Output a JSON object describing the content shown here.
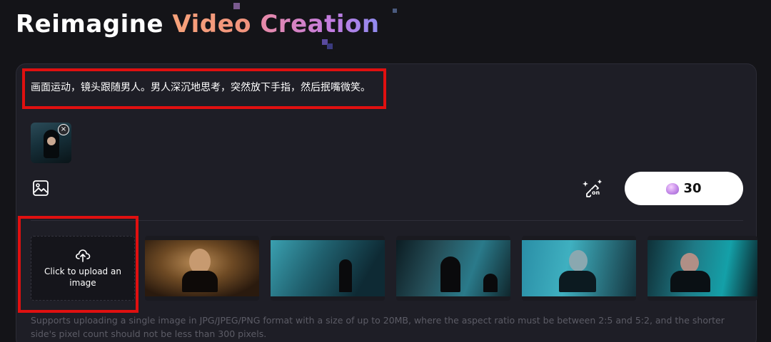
{
  "hero": {
    "word1": "Reimagine",
    "word2": "Video",
    "word3": "Creation"
  },
  "prompt": {
    "text": "画面运动，镜头跟随男人。男人深沉地思考，突然放下手指，然后抿嘴微笑。"
  },
  "reference_image": {
    "remove_glyph": "×"
  },
  "toolbar": {
    "image_icon": "image-icon",
    "ai_toggle_icon": "magic-edit-icon",
    "ai_toggle_label": "on",
    "credits_value": "30",
    "credits_icon": "shell-gem-icon"
  },
  "upload": {
    "icon": "cloud-upload-icon",
    "label": "Click to upload an image"
  },
  "gallery": {
    "frames": [
      "f1",
      "f2",
      "f3",
      "f4",
      "f5"
    ]
  },
  "hint": "Supports uploading a single image in JPG/JPEG/PNG format with a size of up to 20MB, where the aspect ratio must be between 2:5 and 5:2, and the shorter side's pixel count should not be less than 300 pixels.",
  "colors": {
    "background": "#141418",
    "card": "#1e1e26",
    "highlight_box": "#e01010",
    "gradient_orange": "#f7a27a",
    "gradient_pink": "#e88aa6",
    "gradient_violet": "#8f8cf0"
  }
}
